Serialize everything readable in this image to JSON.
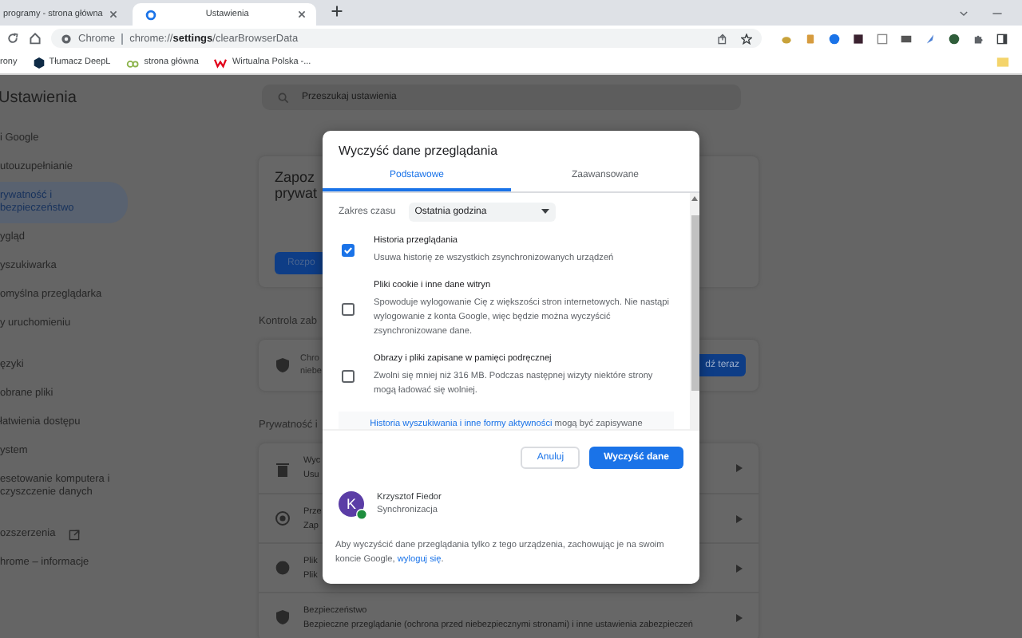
{
  "browser": {
    "tabs": [
      {
        "title": "programy - strona główna",
        "selected": false
      },
      {
        "title": "Ustawienia",
        "selected": true
      }
    ],
    "omnibox": {
      "origin": "Chrome",
      "url": "chrome://**settings**/clearBrowserData"
    },
    "bookmarks": [
      {
        "label": "rony",
        "kind": "plain"
      },
      {
        "label": "Tłumacz DeepL",
        "kind": "deepl"
      },
      {
        "label": "strona główna",
        "kind": "dp"
      },
      {
        "label": "Wirtualna Polska -...",
        "kind": "wp"
      }
    ]
  },
  "settings": {
    "title": "Ustawienia",
    "search": {
      "placeholder": "Przeszukaj ustawienia"
    },
    "sidebar": {
      "groups": [
        {
          "items": [
            {
              "label": "i Google",
              "selected": false,
              "kind": "page"
            },
            {
              "label": "utouzupełnianie",
              "selected": false,
              "kind": "page"
            },
            {
              "label": "rywatność i bezpieczeństwo",
              "selected": true,
              "kind": "page"
            },
            {
              "label": "ygląd",
              "selected": false,
              "kind": "page"
            },
            {
              "label": "yszukiwarka",
              "selected": false,
              "kind": "page"
            },
            {
              "label": "omyślna przeglądarka",
              "selected": false,
              "kind": "page"
            },
            {
              "label": "y uruchomieniu",
              "selected": false,
              "kind": "page"
            }
          ]
        },
        {
          "items": [
            {
              "label": "ęzyki",
              "selected": false,
              "kind": "page"
            },
            {
              "label": "obrane pliki",
              "selected": false,
              "kind": "page"
            },
            {
              "label": "łatwienia dostępu",
              "selected": false,
              "kind": "page"
            },
            {
              "label": "ystem",
              "selected": false,
              "kind": "page"
            },
            {
              "label": "esetowanie komputera i czyszczenie danych",
              "selected": false,
              "kind": "page"
            }
          ]
        },
        {
          "items": [
            {
              "label": "ozszerzenia",
              "selected": false,
              "kind": "external"
            },
            {
              "label": "hrome – informacje",
              "selected": false,
              "kind": "page"
            }
          ]
        }
      ]
    },
    "privacy_guide": {
      "title": "Zapoz prywat",
      "button": "Rozpo"
    },
    "safety_check": {
      "heading": "Kontrola zab",
      "title": "Chro",
      "subtitle": "niebe",
      "button": "dź teraz"
    },
    "privacy": {
      "heading": "Prywatność i",
      "rows": [
        {
          "kind": "trash",
          "title": "Wyc",
          "description": "Usu"
        },
        {
          "kind": "target",
          "title": "Prze",
          "description": "Zap"
        },
        {
          "kind": "cookie",
          "title": "Plik",
          "description": "Plik"
        },
        {
          "kind": "shield",
          "title": "Bezpieczeństwo",
          "description": "Bezpieczne przeglądanie (ochrona przed niebezpiecznymi stronami) i inne ustawienia zabezpieczeń"
        }
      ]
    }
  },
  "dialog": {
    "title": "Wyczyść dane przeglądania",
    "tabs": [
      {
        "label": "Podstawowe",
        "selected": true
      },
      {
        "label": "Zaawansowane",
        "selected": false
      }
    ],
    "time_range": {
      "label": "Zakres czasu",
      "value": "Ostatnia godzina"
    },
    "options": [
      {
        "title": "Historia przeglądania",
        "description": "Usuwa historię ze wszystkich zsynchronizowanych urządzeń",
        "checked": true
      },
      {
        "title": "Pliki cookie i inne dane witryn",
        "description": "Spowoduje wylogowanie Cię z większości stron internetowych. Nie nastąpi wylogowanie z konta Google, więc będzie można wyczyścić zsynchronizowane dane.",
        "checked": false
      },
      {
        "title": "Obrazy i pliki zapisane w pamięci podręcznej",
        "description": "Zwolni się mniej niż 316 MB. Podczas następnej wizyty niektóre strony mogą ładować się wolniej.",
        "checked": false
      }
    ],
    "notice": {
      "link": "Historia wyszukiwania i inne formy aktywności",
      "text": "mogą być zapisywane"
    },
    "buttons": [
      {
        "label": "Anuluj",
        "kind": "secondary"
      },
      {
        "label": "Wyczyść dane",
        "kind": "primary"
      }
    ],
    "account": {
      "initial": "K",
      "name": "Krzysztof Fiedor",
      "status": "Synchronizacja"
    },
    "footer": {
      "text": "Aby wyczyścić dane przeglądania tylko z tego urządzenia, zachowując je na swoim koncie Google,",
      "link": "wyloguj się",
      "end": "."
    }
  }
}
